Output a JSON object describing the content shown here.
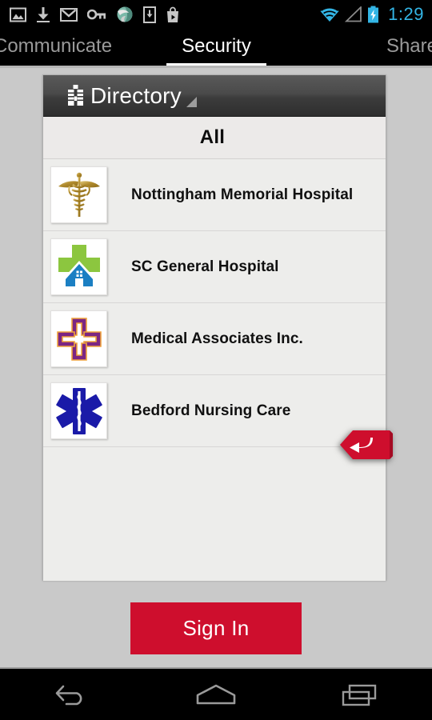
{
  "status_bar": {
    "icons": [
      "gallery-icon",
      "download-icon",
      "gmail-icon",
      "key-icon",
      "browser-icon",
      "download-to-device-icon",
      "play-store-icon"
    ],
    "right_icons": [
      "wifi-icon",
      "signal-icon",
      "battery-charging-icon"
    ],
    "time": "1:29",
    "accent_color": "#33b5e5"
  },
  "tabs": [
    {
      "label": "Communicate",
      "active": false
    },
    {
      "label": "Security",
      "active": true
    },
    {
      "label": "Share",
      "active": false
    }
  ],
  "directory": {
    "icon": "building-icon",
    "title": "Directory",
    "caret": "dropdown-caret-icon",
    "filter_label": "All",
    "items": [
      {
        "label": "Nottingham Memorial Hospital",
        "icon": "caduceus-icon"
      },
      {
        "label": "SC General Hospital",
        "icon": "cross-house-icon"
      },
      {
        "label": "Medical Associates Inc.",
        "icon": "pinwheel-cross-icon"
      },
      {
        "label": "Bedford Nursing Care",
        "icon": "star-of-life-icon"
      }
    ],
    "return_tab": "return-arrow-icon"
  },
  "sign_in": {
    "label": "Sign In",
    "color": "#ce0e2d"
  },
  "nav_bar": {
    "back": "back-icon",
    "home": "home-icon",
    "recents": "recents-icon"
  },
  "colors": {
    "background": "#c9c9c9",
    "panel": "#ededeb",
    "accent_red": "#ce0e2d",
    "status_blue": "#33b5e5"
  }
}
